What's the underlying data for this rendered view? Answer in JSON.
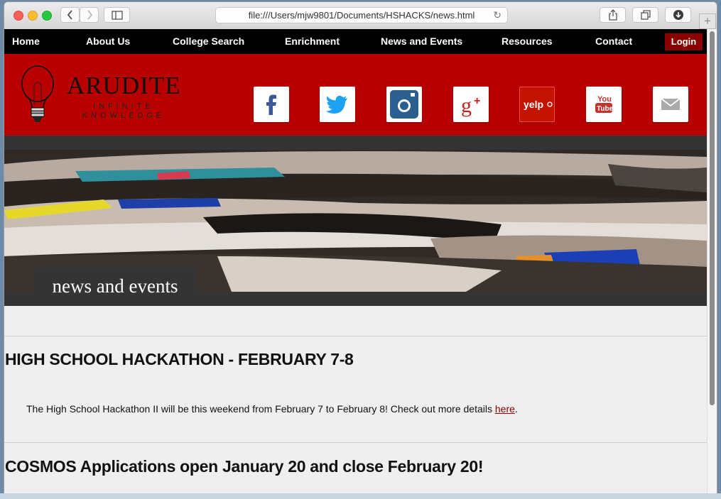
{
  "browser": {
    "url": "file:///Users/mjw9801/Documents/HSHACKS/news.html",
    "new_tab_symbol": "+"
  },
  "nav": {
    "items": [
      "Home",
      "About Us",
      "College Search",
      "Enrichment",
      "News and Events",
      "Resources",
      "Contact"
    ],
    "login_label": "Login"
  },
  "header": {
    "brand": "ARUDITE",
    "tagline": "INFINITE KNOWLEDGE",
    "social_icons": [
      "facebook-icon",
      "twitter-icon",
      "instagram-icon",
      "google-plus-icon",
      "yelp-icon",
      "youtube-icon",
      "mail-icon"
    ],
    "yelp_text": "yelp",
    "youtube_text_1": "You",
    "youtube_text_2": "Tube"
  },
  "banner": {
    "caption": "news and events"
  },
  "news": {
    "items": [
      {
        "title": "HIGH SCHOOL HACKATHON - FEBRUARY 7-8",
        "body": "The High School Hackathon II will be this weekend from February 7 to February 8! Check out more details ",
        "link_text": "here",
        "after_link": "."
      },
      {
        "title": "COSMOS Applications open January 20 and close February 20!"
      }
    ]
  },
  "colors": {
    "brand_red": "#b90000",
    "login_red": "#8b0000",
    "nav_black": "#000000",
    "band_gray": "#343434"
  }
}
